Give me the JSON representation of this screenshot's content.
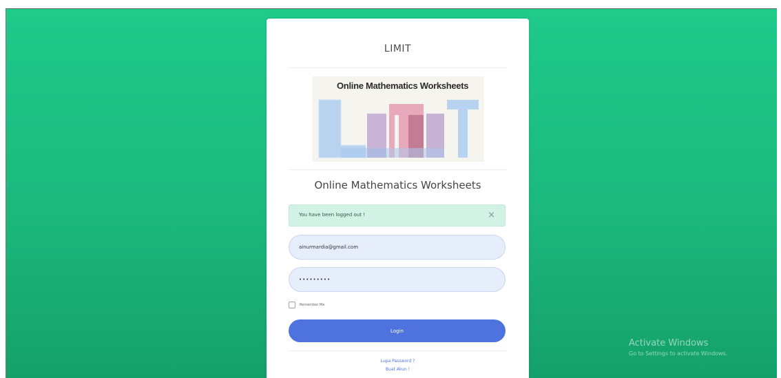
{
  "card": {
    "title": "LIMIT",
    "logo_caption": "Online Mathematics Worksheets",
    "subtitle": "Online Mathematics Worksheets"
  },
  "alert": {
    "message": "You have been logged out !",
    "close_symbol": "×",
    "background": "#d2f2e6"
  },
  "form": {
    "email_value": "ainurmardia@gmail.com",
    "password_value": "•••••••••",
    "remember_label": "Remember Me",
    "login_label": "Login",
    "accent_color": "#4e73df"
  },
  "links": {
    "forgot_password": "Lupa Password ?",
    "create_account": "Buat Akun !"
  },
  "watermark": {
    "title": "Activate Windows",
    "subtitle": "Go to Settings to activate Windows."
  },
  "theme": {
    "background_green": "#1fca8b"
  }
}
